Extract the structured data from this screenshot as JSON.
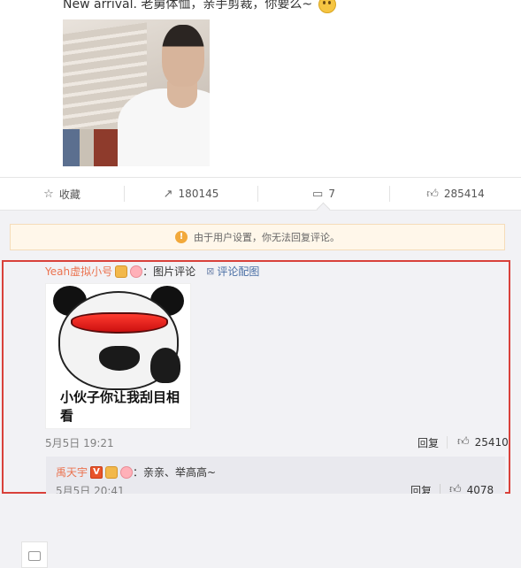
{
  "post": {
    "text": "New arrival. 老舅体恤，亲手剪裁，你要么~"
  },
  "actions": {
    "favorite_label": "收藏",
    "share_count": "180145",
    "comment_count": "7",
    "like_count": "285414"
  },
  "notice": {
    "text": "由于用户设置，你无法回复评论。"
  },
  "comment": {
    "username": "Yeah虚拟小号",
    "body": "：图片评论",
    "pic_link": "评论配图",
    "meme_caption": "小伙子你让我刮目相看",
    "time": "5月5日 19:21",
    "reply_label": "回复",
    "like_count": "25410"
  },
  "reply": {
    "username": "禹天宇",
    "body": "：亲亲、举高高~",
    "time": "5月5日 20:41",
    "reply_label": "回复",
    "like_count": "4078"
  },
  "colors": {
    "highlight_border": "#d9413a",
    "username": "#eb7350",
    "link": "#4a6fa5",
    "notice_bg": "#fff7ea"
  }
}
